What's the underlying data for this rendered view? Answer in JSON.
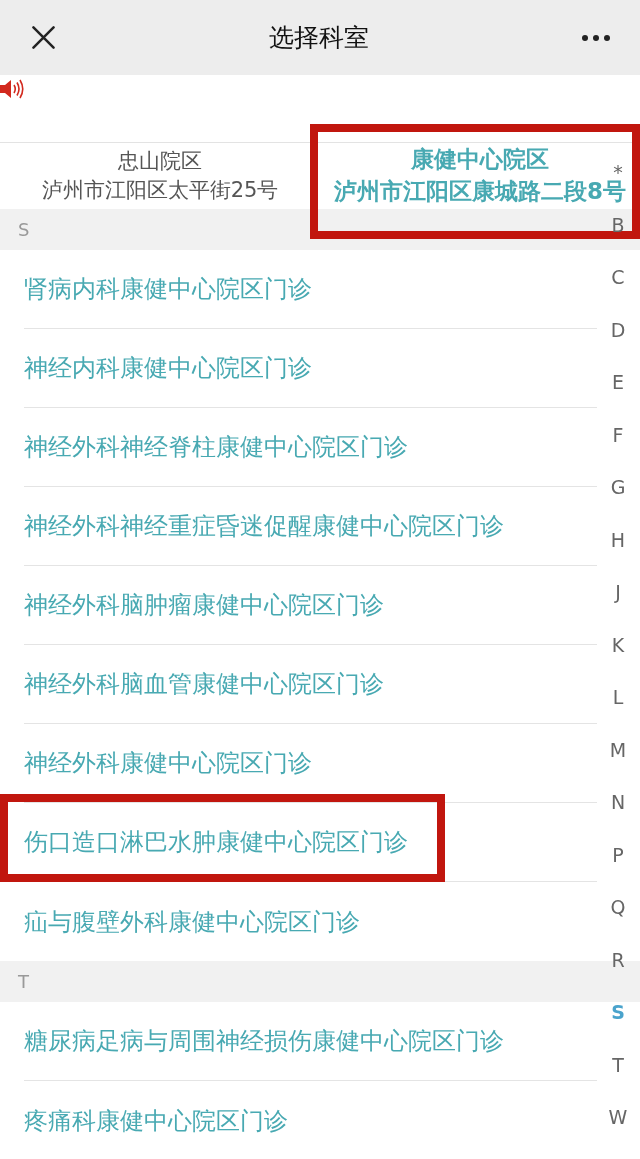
{
  "nav": {
    "title": "选择科室"
  },
  "campuses": [
    {
      "name": "忠山院区",
      "address": "泸州市江阳区太平街25号",
      "selected": false,
      "highlighted": false
    },
    {
      "name": "康健中心院区",
      "address": "泸州市江阳区康城路二段8号",
      "selected": true,
      "highlighted": true
    }
  ],
  "sections": [
    {
      "letter": "S",
      "items": [
        {
          "label": "肾病内科康健中心院区门诊",
          "highlighted": false
        },
        {
          "label": "神经内科康健中心院区门诊",
          "highlighted": false
        },
        {
          "label": "神经外科神经脊柱康健中心院区门诊",
          "highlighted": false
        },
        {
          "label": "神经外科神经重症昏迷促醒康健中心院区门诊",
          "highlighted": false
        },
        {
          "label": "神经外科脑肿瘤康健中心院区门诊",
          "highlighted": false
        },
        {
          "label": "神经外科脑血管康健中心院区门诊",
          "highlighted": false
        },
        {
          "label": "神经外科康健中心院区门诊",
          "highlighted": false
        },
        {
          "label": "伤口造口淋巴水肿康健中心院区门诊",
          "highlighted": true
        },
        {
          "label": "疝与腹壁外科康健中心院区门诊",
          "highlighted": false
        }
      ]
    },
    {
      "letter": "T",
      "items": [
        {
          "label": "糖尿病足病与周围神经损伤康健中心院区门诊",
          "highlighted": false
        },
        {
          "label": "疼痛科康健中心院区门诊",
          "highlighted": false
        }
      ]
    }
  ],
  "index": [
    {
      "label": "*",
      "selected": false
    },
    {
      "label": "B",
      "selected": false
    },
    {
      "label": "C",
      "selected": false
    },
    {
      "label": "D",
      "selected": false
    },
    {
      "label": "E",
      "selected": false
    },
    {
      "label": "F",
      "selected": false
    },
    {
      "label": "G",
      "selected": false
    },
    {
      "label": "H",
      "selected": false
    },
    {
      "label": "J",
      "selected": false
    },
    {
      "label": "K",
      "selected": false
    },
    {
      "label": "L",
      "selected": false
    },
    {
      "label": "M",
      "selected": false
    },
    {
      "label": "N",
      "selected": false
    },
    {
      "label": "P",
      "selected": false
    },
    {
      "label": "Q",
      "selected": false
    },
    {
      "label": "R",
      "selected": false
    },
    {
      "label": "S",
      "selected": true
    },
    {
      "label": "T",
      "selected": false
    },
    {
      "label": "W",
      "selected": false
    }
  ]
}
